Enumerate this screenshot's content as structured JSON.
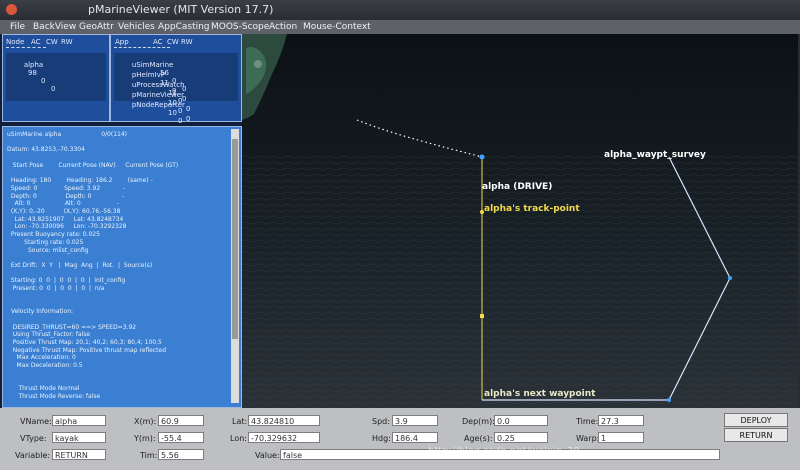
{
  "window": {
    "title": "pMarineViewer (MIT Version 17.7)"
  },
  "menu": [
    "File",
    "BackView",
    "GeoAttr",
    "Vehicles",
    "AppCasting",
    "MOOS-Scope",
    "Action",
    "Mouse-Context"
  ],
  "node_panel": {
    "headers": [
      "Node",
      "AC",
      "CW",
      "RW"
    ],
    "rows": [
      [
        "alpha",
        "98",
        "0",
        "0"
      ]
    ]
  },
  "app_panel": {
    "headers": [
      "App",
      "AC",
      "CW",
      "RW"
    ],
    "rows": [
      [
        "uSimMarine",
        "56",
        "0",
        "0"
      ],
      [
        "pHelmIvP",
        "11",
        "0",
        "0"
      ],
      [
        "uProcessWatch",
        "11",
        "0",
        "0"
      ],
      [
        "pMarineViewer",
        "10",
        "0",
        "0"
      ],
      [
        "pNodeReporter",
        "10",
        "0",
        "0"
      ]
    ]
  },
  "appcast": {
    "lines": [
      "uSimMarine alpha                     0/0(114)",
      "",
      "Datum: 43.8253,-70.3304",
      "",
      "   Start Pose        Current Pose (NAV)     Current Pose (GT)",
      "",
      "  Heading: 180        Heading: 186.2        (same) -",
      "  Speed: 0              Speed: 3.92            -",
      "  Depth: 0               Depth: 0                -",
      "    Alt: 0                  Alt: 0                   -",
      "  (X,Y): 0,-20          (X,Y): 60.76,-56.38",
      "    Lat: 43.8251907     Lat: 43.8248734",
      "    Lon: -70.330096     Lon: -70.3292328",
      "  Present Buoyancy rate: 0.025",
      "         Starting rate: 0.025",
      "           Source: mlist_config",
      "",
      "  Ext Drift:  X  Y   |  Mag  Ang  |  Rot.  |  Source(s)",
      "",
      "  Starting: 0  0  |  0  0  |  0  |  init_config",
      "   Present: 0  0  |  0  0  |  0  |  n/a",
      "",
      "",
      "  Velocity Information:",
      "",
      "   DESIRED_THRUST=60 ==> SPEED=3.92",
      "   Using Thrust_Factor: false",
      "   Positive Thrust Map: 20,1; 40,2; 60,3; 80,4; 100,5",
      "   Negative Thrust Map: Positive thrust map reflected",
      "     Max Acceleration: 0",
      "     Max Deceleration: 0.5",
      "",
      "",
      "      Thrust Mode Normal",
      "      Thrust Mode Reverse: false"
    ]
  },
  "map": {
    "labels": {
      "vehicle": "alpha (DRIVE)",
      "track_point": "alpha's track-point",
      "next_waypoint": "alpha's next waypoint",
      "survey": "alpha_waypt_survey"
    },
    "colors": {
      "vehicle_label": "#ffffff",
      "track_point": "#f2d94a",
      "next_waypoint": "#e8e8c8",
      "survey": "#ffffff",
      "survey_line": "#d8e4ff",
      "trail": "#ffffff"
    }
  },
  "fields": {
    "vname": {
      "label": "VName:",
      "value": "alpha"
    },
    "vtype": {
      "label": "VType:",
      "value": "kayak"
    },
    "variable": {
      "label": "Variable:",
      "value": "RETURN"
    },
    "xm": {
      "label": "X(m):",
      "value": "60.9"
    },
    "ym": {
      "label": "Y(m):",
      "value": "-55.4"
    },
    "tim": {
      "label": "Tim:",
      "value": "5.56"
    },
    "lat": {
      "label": "Lat:",
      "value": "43.824810"
    },
    "lon": {
      "label": "Lon:",
      "value": "-70.329632"
    },
    "value": {
      "label": "Value:",
      "value": "false"
    },
    "spd": {
      "label": "Spd:",
      "value": "3.9"
    },
    "hdg": {
      "label": "Hdg:",
      "value": "186.4"
    },
    "depm": {
      "label": "Dep(m):",
      "value": "0.0"
    },
    "ages": {
      "label": "Age(s):",
      "value": "0.25"
    },
    "time": {
      "label": "Time:",
      "value": "27.3"
    },
    "warp": {
      "label": "Warp:",
      "value": "1"
    }
  },
  "buttons": {
    "deploy": "DEPLOY",
    "return": "RETURN"
  },
  "watermark": "http://blog.csdn.net/weixin_38"
}
